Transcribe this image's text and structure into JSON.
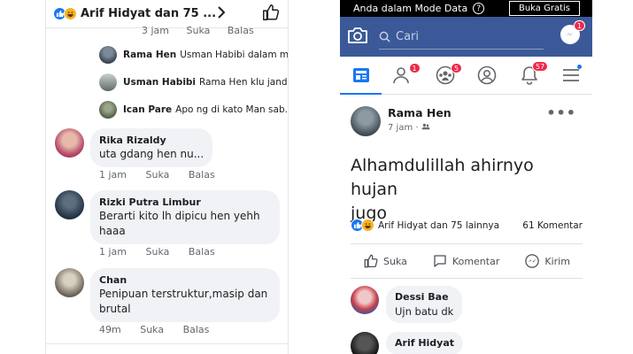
{
  "left": {
    "header": {
      "reactors": "Arif Hidyat dan 75 ..."
    },
    "top_meta": {
      "time": "3 jam",
      "like": "Suka",
      "reply": "Balas"
    },
    "replies": [
      {
        "name": "Rama Hen",
        "text": "Usman Habibi dalam mi..."
      },
      {
        "name": "Usman Habibi",
        "text": "Rama Hen klu jand..."
      },
      {
        "name": "Ican Pare",
        "text": "Apo ng di kato Man sab..."
      }
    ],
    "comments": [
      {
        "name": "Rika Rizaldy",
        "text": "uta gdang hen nu...",
        "time": "1 jam",
        "like": "Suka",
        "reply": "Balas"
      },
      {
        "name": "Rizki Putra Limbur",
        "text_lines": [
          "Berarti kito lh dipicu hen yehh",
          "haaa"
        ],
        "time": "1 jam",
        "like": "Suka",
        "reply": "Balas"
      },
      {
        "name": "Chan",
        "text_lines": [
          "Penipuan terstruktur,masip dan",
          "brutal"
        ],
        "time": "49m",
        "like": "Suka",
        "reply": "Balas"
      }
    ]
  },
  "right": {
    "data_bar": {
      "text": "Anda dalam Mode Data",
      "help": "?",
      "button": "Buka Gratis"
    },
    "search_placeholder": "Cari",
    "badges": {
      "messenger": "1",
      "friends": "1",
      "groups": "5",
      "notifications": "57"
    },
    "post": {
      "author": "Rama Hen",
      "time": "7 jam ·",
      "more": "•••",
      "text_lines": [
        "Alhamdulillah ahirnyo hujan",
        "jugo"
      ],
      "reactors": "Arif Hidyat dan 75 lainnya",
      "comment_count": "61 Komentar"
    },
    "actions": {
      "like": "Suka",
      "comment": "Komentar",
      "share": "Kirim"
    },
    "comments": [
      {
        "name": "Dessi Bae",
        "text": "Ujn batu dk"
      },
      {
        "name": "Arif Hidyat",
        "text": ""
      }
    ]
  }
}
